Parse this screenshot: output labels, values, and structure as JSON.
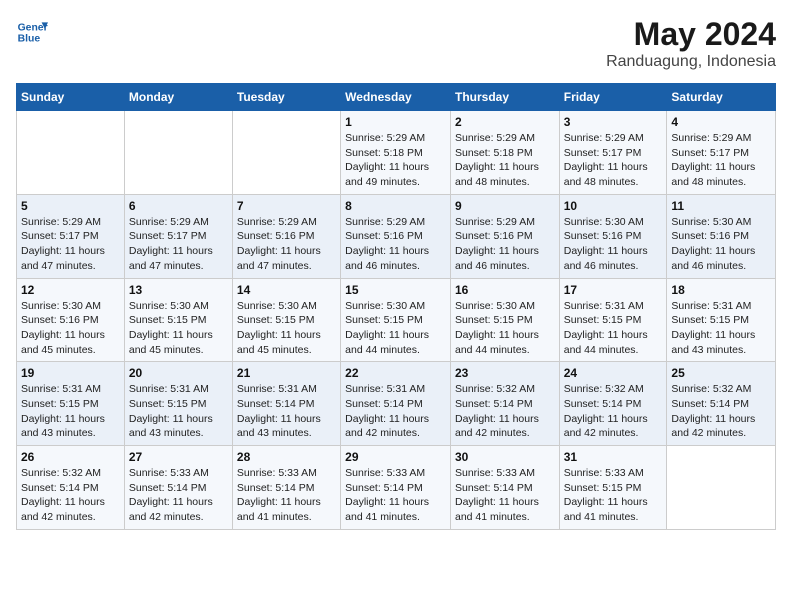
{
  "header": {
    "logo_line1": "General",
    "logo_line2": "Blue",
    "title": "May 2024",
    "subtitle": "Randuagung, Indonesia"
  },
  "calendar": {
    "days_of_week": [
      "Sunday",
      "Monday",
      "Tuesday",
      "Wednesday",
      "Thursday",
      "Friday",
      "Saturday"
    ],
    "weeks": [
      [
        {
          "day": "",
          "info": ""
        },
        {
          "day": "",
          "info": ""
        },
        {
          "day": "",
          "info": ""
        },
        {
          "day": "1",
          "info": "Sunrise: 5:29 AM\nSunset: 5:18 PM\nDaylight: 11 hours\nand 49 minutes."
        },
        {
          "day": "2",
          "info": "Sunrise: 5:29 AM\nSunset: 5:18 PM\nDaylight: 11 hours\nand 48 minutes."
        },
        {
          "day": "3",
          "info": "Sunrise: 5:29 AM\nSunset: 5:17 PM\nDaylight: 11 hours\nand 48 minutes."
        },
        {
          "day": "4",
          "info": "Sunrise: 5:29 AM\nSunset: 5:17 PM\nDaylight: 11 hours\nand 48 minutes."
        }
      ],
      [
        {
          "day": "5",
          "info": "Sunrise: 5:29 AM\nSunset: 5:17 PM\nDaylight: 11 hours\nand 47 minutes."
        },
        {
          "day": "6",
          "info": "Sunrise: 5:29 AM\nSunset: 5:17 PM\nDaylight: 11 hours\nand 47 minutes."
        },
        {
          "day": "7",
          "info": "Sunrise: 5:29 AM\nSunset: 5:16 PM\nDaylight: 11 hours\nand 47 minutes."
        },
        {
          "day": "8",
          "info": "Sunrise: 5:29 AM\nSunset: 5:16 PM\nDaylight: 11 hours\nand 46 minutes."
        },
        {
          "day": "9",
          "info": "Sunrise: 5:29 AM\nSunset: 5:16 PM\nDaylight: 11 hours\nand 46 minutes."
        },
        {
          "day": "10",
          "info": "Sunrise: 5:30 AM\nSunset: 5:16 PM\nDaylight: 11 hours\nand 46 minutes."
        },
        {
          "day": "11",
          "info": "Sunrise: 5:30 AM\nSunset: 5:16 PM\nDaylight: 11 hours\nand 46 minutes."
        }
      ],
      [
        {
          "day": "12",
          "info": "Sunrise: 5:30 AM\nSunset: 5:16 PM\nDaylight: 11 hours\nand 45 minutes."
        },
        {
          "day": "13",
          "info": "Sunrise: 5:30 AM\nSunset: 5:15 PM\nDaylight: 11 hours\nand 45 minutes."
        },
        {
          "day": "14",
          "info": "Sunrise: 5:30 AM\nSunset: 5:15 PM\nDaylight: 11 hours\nand 45 minutes."
        },
        {
          "day": "15",
          "info": "Sunrise: 5:30 AM\nSunset: 5:15 PM\nDaylight: 11 hours\nand 44 minutes."
        },
        {
          "day": "16",
          "info": "Sunrise: 5:30 AM\nSunset: 5:15 PM\nDaylight: 11 hours\nand 44 minutes."
        },
        {
          "day": "17",
          "info": "Sunrise: 5:31 AM\nSunset: 5:15 PM\nDaylight: 11 hours\nand 44 minutes."
        },
        {
          "day": "18",
          "info": "Sunrise: 5:31 AM\nSunset: 5:15 PM\nDaylight: 11 hours\nand 43 minutes."
        }
      ],
      [
        {
          "day": "19",
          "info": "Sunrise: 5:31 AM\nSunset: 5:15 PM\nDaylight: 11 hours\nand 43 minutes."
        },
        {
          "day": "20",
          "info": "Sunrise: 5:31 AM\nSunset: 5:15 PM\nDaylight: 11 hours\nand 43 minutes."
        },
        {
          "day": "21",
          "info": "Sunrise: 5:31 AM\nSunset: 5:14 PM\nDaylight: 11 hours\nand 43 minutes."
        },
        {
          "day": "22",
          "info": "Sunrise: 5:31 AM\nSunset: 5:14 PM\nDaylight: 11 hours\nand 42 minutes."
        },
        {
          "day": "23",
          "info": "Sunrise: 5:32 AM\nSunset: 5:14 PM\nDaylight: 11 hours\nand 42 minutes."
        },
        {
          "day": "24",
          "info": "Sunrise: 5:32 AM\nSunset: 5:14 PM\nDaylight: 11 hours\nand 42 minutes."
        },
        {
          "day": "25",
          "info": "Sunrise: 5:32 AM\nSunset: 5:14 PM\nDaylight: 11 hours\nand 42 minutes."
        }
      ],
      [
        {
          "day": "26",
          "info": "Sunrise: 5:32 AM\nSunset: 5:14 PM\nDaylight: 11 hours\nand 42 minutes."
        },
        {
          "day": "27",
          "info": "Sunrise: 5:33 AM\nSunset: 5:14 PM\nDaylight: 11 hours\nand 42 minutes."
        },
        {
          "day": "28",
          "info": "Sunrise: 5:33 AM\nSunset: 5:14 PM\nDaylight: 11 hours\nand 41 minutes."
        },
        {
          "day": "29",
          "info": "Sunrise: 5:33 AM\nSunset: 5:14 PM\nDaylight: 11 hours\nand 41 minutes."
        },
        {
          "day": "30",
          "info": "Sunrise: 5:33 AM\nSunset: 5:14 PM\nDaylight: 11 hours\nand 41 minutes."
        },
        {
          "day": "31",
          "info": "Sunrise: 5:33 AM\nSunset: 5:15 PM\nDaylight: 11 hours\nand 41 minutes."
        },
        {
          "day": "",
          "info": ""
        }
      ]
    ]
  }
}
